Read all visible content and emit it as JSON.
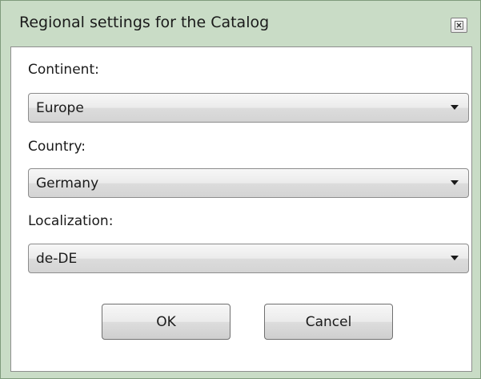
{
  "window": {
    "title": "Regional settings for the Catalog",
    "close_icon": "close-icon"
  },
  "fields": {
    "continent": {
      "label": "Continent:",
      "value": "Europe"
    },
    "country": {
      "label": "Country:",
      "value": "Germany"
    },
    "localization": {
      "label": "Localization:",
      "value": "de-DE"
    }
  },
  "buttons": {
    "ok_label": "OK",
    "cancel_label": "Cancel"
  },
  "colors": {
    "frame": "#c9dcc6",
    "client_background": "#ffffff"
  }
}
